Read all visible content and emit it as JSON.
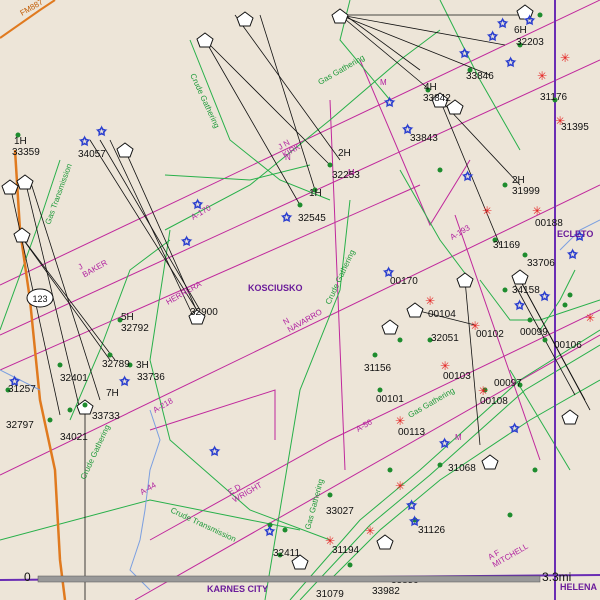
{
  "roads": {
    "fm": "FM887",
    "route": "123"
  },
  "places": {
    "city": "KARNES CITY",
    "town": "ECLETO",
    "helena": "HELENA",
    "kosciusko": "KOSCIUSKO"
  },
  "survey_labels": [
    "J N\nKIRK",
    "J\nBAKER",
    "HERRERA",
    "N\nNAVARRO",
    "E D\nWRIGHT",
    "A F\nMITCHELL",
    "M",
    "M",
    "N",
    "M"
  ],
  "abstracts": [
    "A-170",
    "A-193",
    "A-218",
    "A-44",
    "A-56"
  ],
  "pipelines": [
    "Gas Gathering",
    "Crude Gathering",
    "Gas Transmission",
    "Crude Transmission",
    "Crude Gathering",
    "Gas Gathering",
    "Gas Gathering",
    "Crude Gathering"
  ],
  "well_numbers": [
    "33359",
    "34057",
    "32253",
    "32545",
    "31999",
    "33842",
    "33843",
    "33846",
    "32203",
    "31176",
    "31395",
    "00188",
    "31169",
    "33706",
    "34158",
    "00170",
    "32792",
    "32900",
    "00104",
    "32051",
    "00102",
    "00099",
    "00106",
    "31156",
    "00101",
    "00103",
    "00097",
    "00108",
    "32789",
    "33736",
    "32401",
    "33733",
    "32797",
    "31257",
    "34021",
    "00113",
    "31068",
    "33027",
    "31126",
    "32411",
    "31194",
    "31079",
    "33859",
    "33982"
  ],
  "well_tags": [
    "1H",
    "2H",
    "5H",
    "6H",
    "3H",
    "7H",
    "4H",
    "1H",
    "2H"
  ],
  "scale": {
    "start": "0",
    "end": "3.3mi"
  }
}
